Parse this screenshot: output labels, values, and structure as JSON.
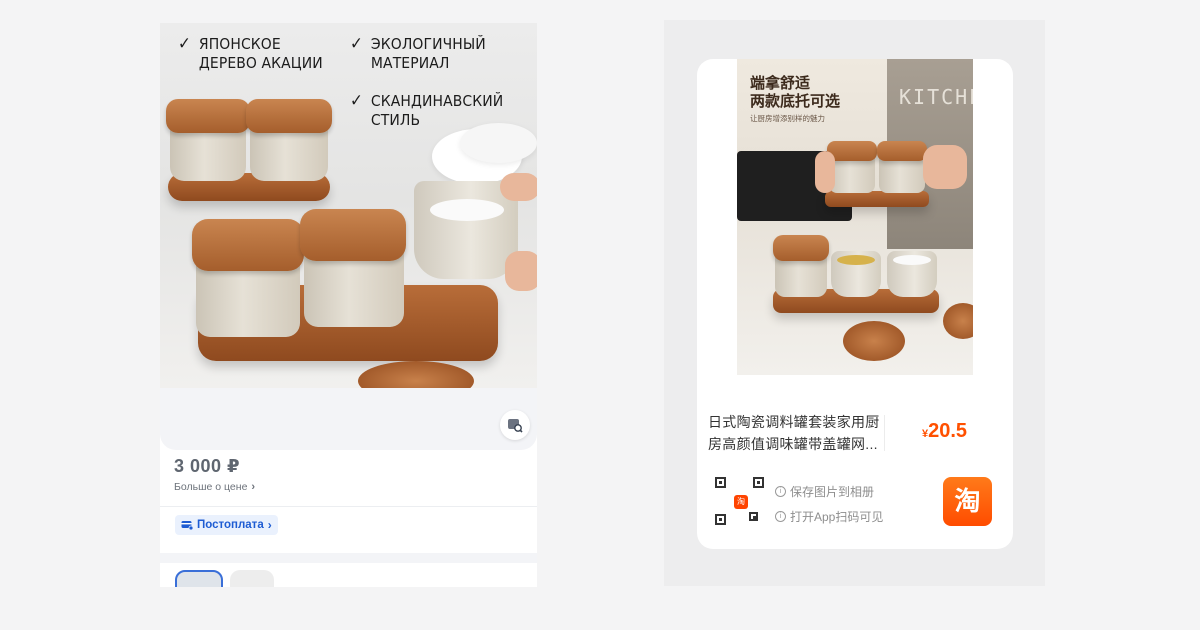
{
  "left_listing": {
    "features": [
      {
        "text": "ЯПОНСКОЕ\nДЕРЕВО АКАЦИИ"
      },
      {
        "text": "ЭКОЛОГИЧНЫЙ\nМАТЕРИАЛ"
      },
      {
        "text": "СКАНДИНАВСКИЙ\nСТИЛЬ"
      }
    ],
    "check_glyph": "✓",
    "price": "3 000 ₽",
    "price_more": "Больше о цене",
    "postpay": "Постоплата",
    "accent_color": "#1e5cd3"
  },
  "right_listing": {
    "promo_title": "端拿舒适\n两款底托可选",
    "promo_sub": "让厨房增添别样的魅力",
    "apron_text": "KITCHE",
    "title": "日式陶瓷调料罐套装家用厨房高颜值调味罐带盖罐网...",
    "currency_symbol": "¥",
    "price": "20.5",
    "hint_save": "保存图片到相册",
    "hint_open": "打开App扫码可见",
    "qr_logo": "淘",
    "app_logo": "淘",
    "accent_color": "#ff5000"
  }
}
